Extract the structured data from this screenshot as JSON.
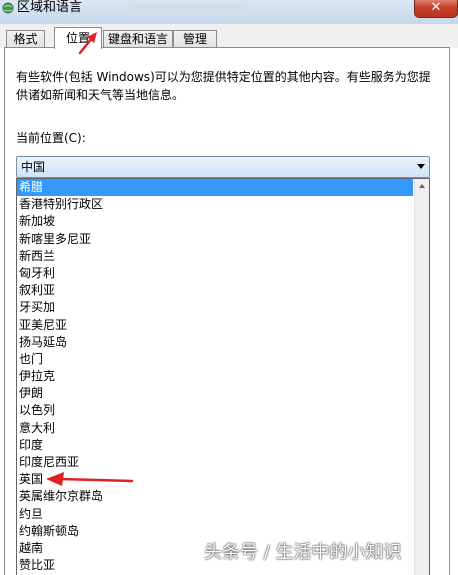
{
  "window": {
    "title": "区域和语言",
    "close_symbol": "✕"
  },
  "tabs": [
    {
      "label": "格式",
      "active": false
    },
    {
      "label": "位置",
      "active": true
    },
    {
      "label": "键盘和语言",
      "active": false
    },
    {
      "label": "管理",
      "active": false
    }
  ],
  "location": {
    "description": "有些软件(包括 Windows)可以为您提供特定位置的其他内容。有些服务为您提供诸如新闻和天气等当地信息。",
    "current_label": "当前位置(C):",
    "current_value": "中国",
    "options": [
      "希腊",
      "香港特别行政区",
      "新加坡",
      "新喀里多尼亚",
      "新西兰",
      "匈牙利",
      "叙利亚",
      "牙买加",
      "亚美尼亚",
      "扬马延岛",
      "也门",
      "伊拉克",
      "伊朗",
      "以色列",
      "意大利",
      "印度",
      "印度尼西亚",
      "英国",
      "英属维尔京群岛",
      "约旦",
      "约翰斯顿岛",
      "越南",
      "赞比亚"
    ],
    "highlighted_index": 0
  },
  "colors": {
    "selection": "#3399ff",
    "annotation_arrow": "#e02020"
  },
  "watermark": "头条号 / 生活中的小知识"
}
